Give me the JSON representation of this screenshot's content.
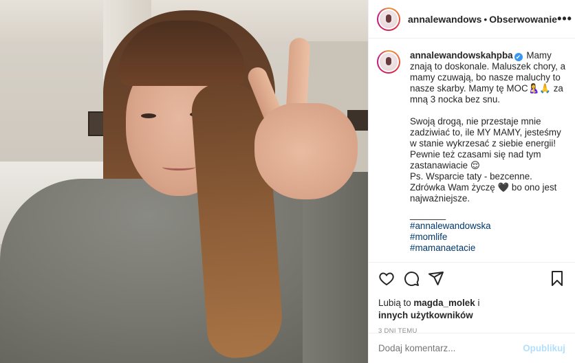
{
  "photo": {
    "alt": ""
  },
  "header": {
    "username": "annalewandows",
    "separator": "•",
    "follow_label": "Obserwowanie",
    "more_icon": "more-icon",
    "more_label": "•••"
  },
  "caption": {
    "username": "annalewandowskahpba",
    "verified_mark": "✔",
    "line1": "Mamy znają to doskonale. Maluszek chory, a mamy czuwają, bo nasze maluchy to nasze skarby. Mamy tę MOC🤱🙏 za mną 3 nocka bez snu.",
    "para2": "Swoją drogą, nie przestaje mnie zadziwiać to, ile MY MAMY, jesteśmy w stanie wykrzesać z siebie energii! Pewnie też czasami się nad tym zastanawiacie 😌",
    "para3_a": "Ps. Wsparcie taty - bezcenne.",
    "para3_b": "Zdrówka Wam życzę 🖤 bo ono jest najważniejsze.",
    "separator": "_______",
    "hashtags": [
      "#annalewandowska",
      "#momlife",
      "#mamanaetacie"
    ]
  },
  "actions": {
    "icons": [
      "heart-icon",
      "comment-icon",
      "share-icon",
      "bookmark-icon"
    ]
  },
  "likes": {
    "prefix": "Lubią to",
    "user": "magda_molek",
    "suffix": "i",
    "others": "innych użytkowników"
  },
  "timestamp": "3 DNI TEMU",
  "comment_box": {
    "placeholder": "Dodaj komentarz...",
    "post_label": "Opublikuj"
  },
  "colors": {
    "link": "#00376b",
    "verified": "#3897f0",
    "post_disabled": "#b2dffc",
    "muted": "#8e8e8e"
  }
}
